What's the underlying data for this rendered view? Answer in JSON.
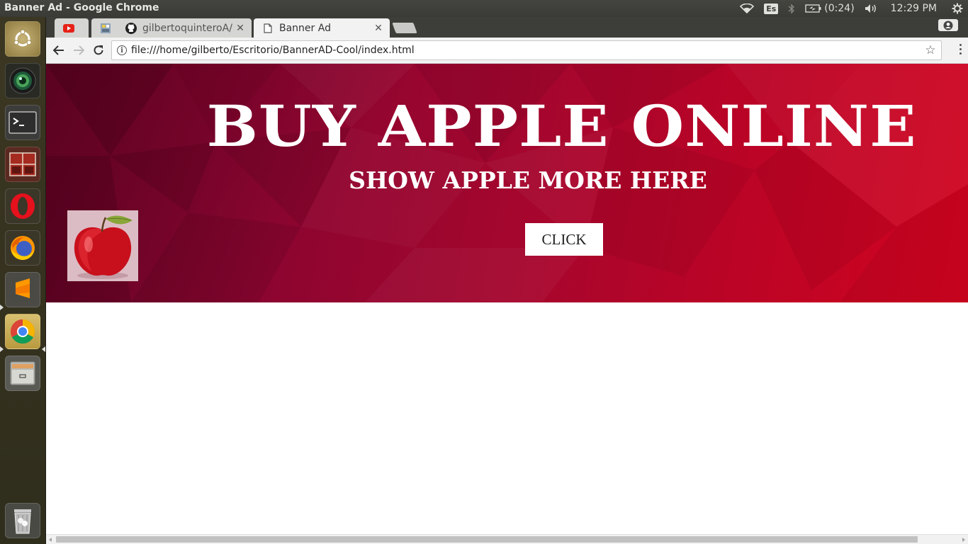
{
  "panel": {
    "window_title": "Banner Ad - Google Chrome",
    "input_language": "Es",
    "battery": "(0:24)",
    "time": "12:29 PM"
  },
  "launcher": {
    "items": [
      "ubuntu-dash",
      "camera-app",
      "terminal",
      "workspace-app",
      "opera",
      "firefox",
      "sublime-text",
      "chrome",
      "files"
    ],
    "trash": "trash"
  },
  "tabs": [
    {
      "label": "",
      "icon": "youtube-icon"
    },
    {
      "label": "",
      "icon": "page-icon"
    },
    {
      "label": "gilbertoquinteroA/",
      "icon": "github-icon"
    },
    {
      "label": "Banner Ad",
      "icon": "document-icon"
    }
  ],
  "toolbar": {
    "url": "file:///home/gilberto/Escritorio/BannerAD-Cool/index.html",
    "info_glyph": "i"
  },
  "banner": {
    "title": "BUY APPLE ONLINE",
    "subtitle": "SHOW APPLE MORE HERE",
    "button_label": "CLICK"
  },
  "colors": {
    "banner_dark": "#6b0428",
    "banner_light": "#d1041f",
    "panel": "#3c3b37"
  }
}
